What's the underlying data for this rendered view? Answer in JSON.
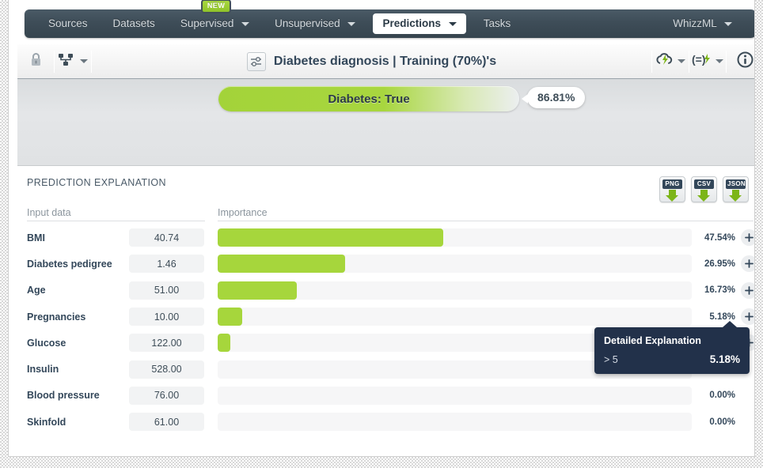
{
  "nav": {
    "items": [
      {
        "label": "Sources",
        "dropdown": false,
        "active": false,
        "badge": null
      },
      {
        "label": "Datasets",
        "dropdown": false,
        "active": false,
        "badge": null
      },
      {
        "label": "Supervised",
        "dropdown": true,
        "active": false,
        "badge": "NEW"
      },
      {
        "label": "Unsupervised",
        "dropdown": true,
        "active": false,
        "badge": null
      },
      {
        "label": "Predictions",
        "dropdown": true,
        "active": true,
        "badge": null
      },
      {
        "label": "Tasks",
        "dropdown": false,
        "active": false,
        "badge": null
      }
    ],
    "account": {
      "label": "WhizzML",
      "dropdown": true
    }
  },
  "toolbar": {
    "lock_icon": "lock-icon",
    "tree_icon": "hierarchy-icon",
    "title_icon": "sliders-icon",
    "title": "Diabetes diagnosis | Training (70%)'s",
    "right_icons": [
      {
        "name": "cloud-lightning-icon",
        "dropdown": true
      },
      {
        "name": "batch-prediction-icon",
        "dropdown": true
      },
      {
        "name": "info-icon",
        "dropdown": false
      }
    ]
  },
  "banner": {
    "prediction_label": "Diabetes: True",
    "confidence": "86.81%",
    "bar_fill_percent": 100
  },
  "panel": {
    "title": "PREDICTION EXPLANATION",
    "columns": {
      "input_data": "Input data",
      "importance": "Importance"
    },
    "download_buttons": [
      {
        "label": "PNG",
        "name": "download-png-button"
      },
      {
        "label": "CSV",
        "name": "download-csv-button"
      },
      {
        "label": "JSON",
        "name": "download-json-button"
      }
    ],
    "expand_icon": "plus-icon"
  },
  "tooltip": {
    "title": "Detailed Explanation",
    "rule": "> 5",
    "value": "5.18%"
  },
  "colors": {
    "bar_green": "#a6d63c",
    "track_gray": "#f6f6f7",
    "nav_dark": "#3e4d58",
    "tooltip_navy": "#22314a",
    "text_navy": "#33475a"
  },
  "chart_data": {
    "type": "bar",
    "title": "PREDICTION EXPLANATION",
    "xlabel": "Importance",
    "ylabel": "Input data",
    "orientation": "horizontal",
    "xlim": [
      0,
      100
    ],
    "grid": false,
    "legend": null,
    "categories": [
      "BMI",
      "Diabetes pedigree",
      "Age",
      "Pregnancies",
      "Glucose",
      "Insulin",
      "Blood pressure",
      "Skinfold"
    ],
    "input_values": [
      "40.74",
      "1.46",
      "51.00",
      "10.00",
      "122.00",
      "528.00",
      "76.00",
      "61.00"
    ],
    "values": [
      47.54,
      26.95,
      16.73,
      5.18,
      2.68,
      0.0,
      0.0,
      0.0
    ],
    "value_labels": [
      "47.54%",
      "26.95%",
      "16.73%",
      "5.18%",
      "2.68%",
      "0.00%",
      "0.00%",
      "0.00%"
    ]
  }
}
